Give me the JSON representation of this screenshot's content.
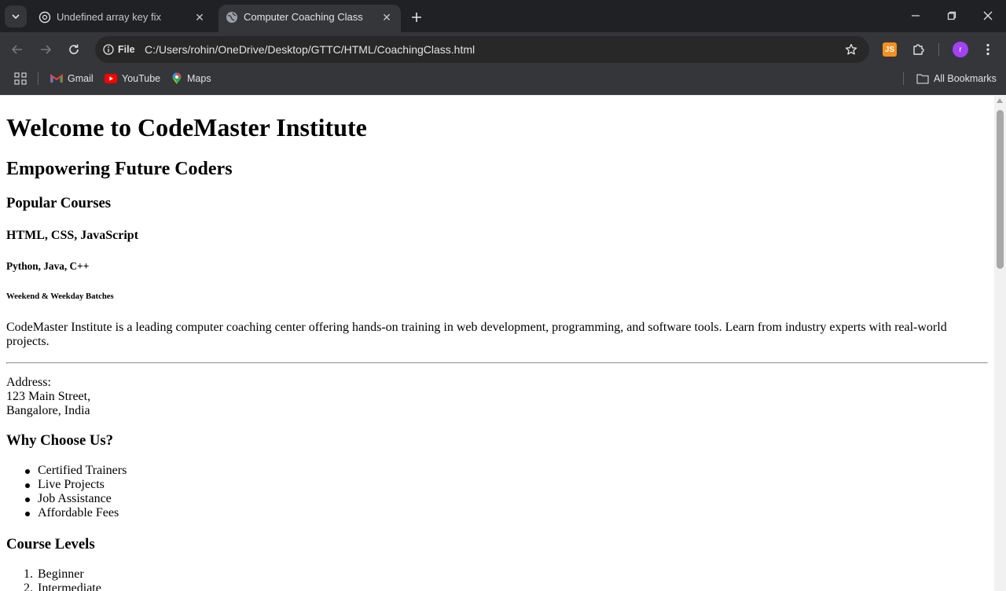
{
  "browser": {
    "tabs": [
      {
        "title": "Undefined array key fix",
        "icon": "chatgpt-icon",
        "active": false
      },
      {
        "title": "Computer Coaching Class",
        "icon": "globe-icon",
        "active": true
      }
    ],
    "address": {
      "chip_label": "File",
      "url": "C:/Users/rohin/OneDrive/Desktop/GTTC/HTML/CoachingClass.html"
    },
    "extensions": {
      "js_label": "JS"
    },
    "profile_initial": "r",
    "bookmarks": [
      {
        "label": "Gmail",
        "icon": "gmail-icon"
      },
      {
        "label": "YouTube",
        "icon": "youtube-icon"
      },
      {
        "label": "Maps",
        "icon": "maps-icon"
      }
    ],
    "all_bookmarks": "All Bookmarks"
  },
  "page": {
    "h1": "Welcome to CodeMaster Institute",
    "h2": "Empowering Future Coders",
    "h3": "Popular Courses",
    "h4": "HTML, CSS, JavaScript",
    "h5": "Python, Java, C++",
    "h6": "Weekend & Weekday Batches",
    "paragraph": "CodeMaster Institute is a leading computer coaching center offering hands-on training in web development, programming, and software tools. Learn from industry experts with real-world projects.",
    "address": [
      "Address:",
      "123 Main Street,",
      "Bangalore, India"
    ],
    "why_title": "Why Choose Us?",
    "why_items": [
      "Certified Trainers",
      "Live Projects",
      "Job Assistance",
      "Affordable Fees"
    ],
    "levels_title": "Course Levels",
    "levels": [
      {
        "num": "1.",
        "label": "Beginner"
      },
      {
        "num": "2.",
        "label": "Intermediate"
      }
    ]
  }
}
